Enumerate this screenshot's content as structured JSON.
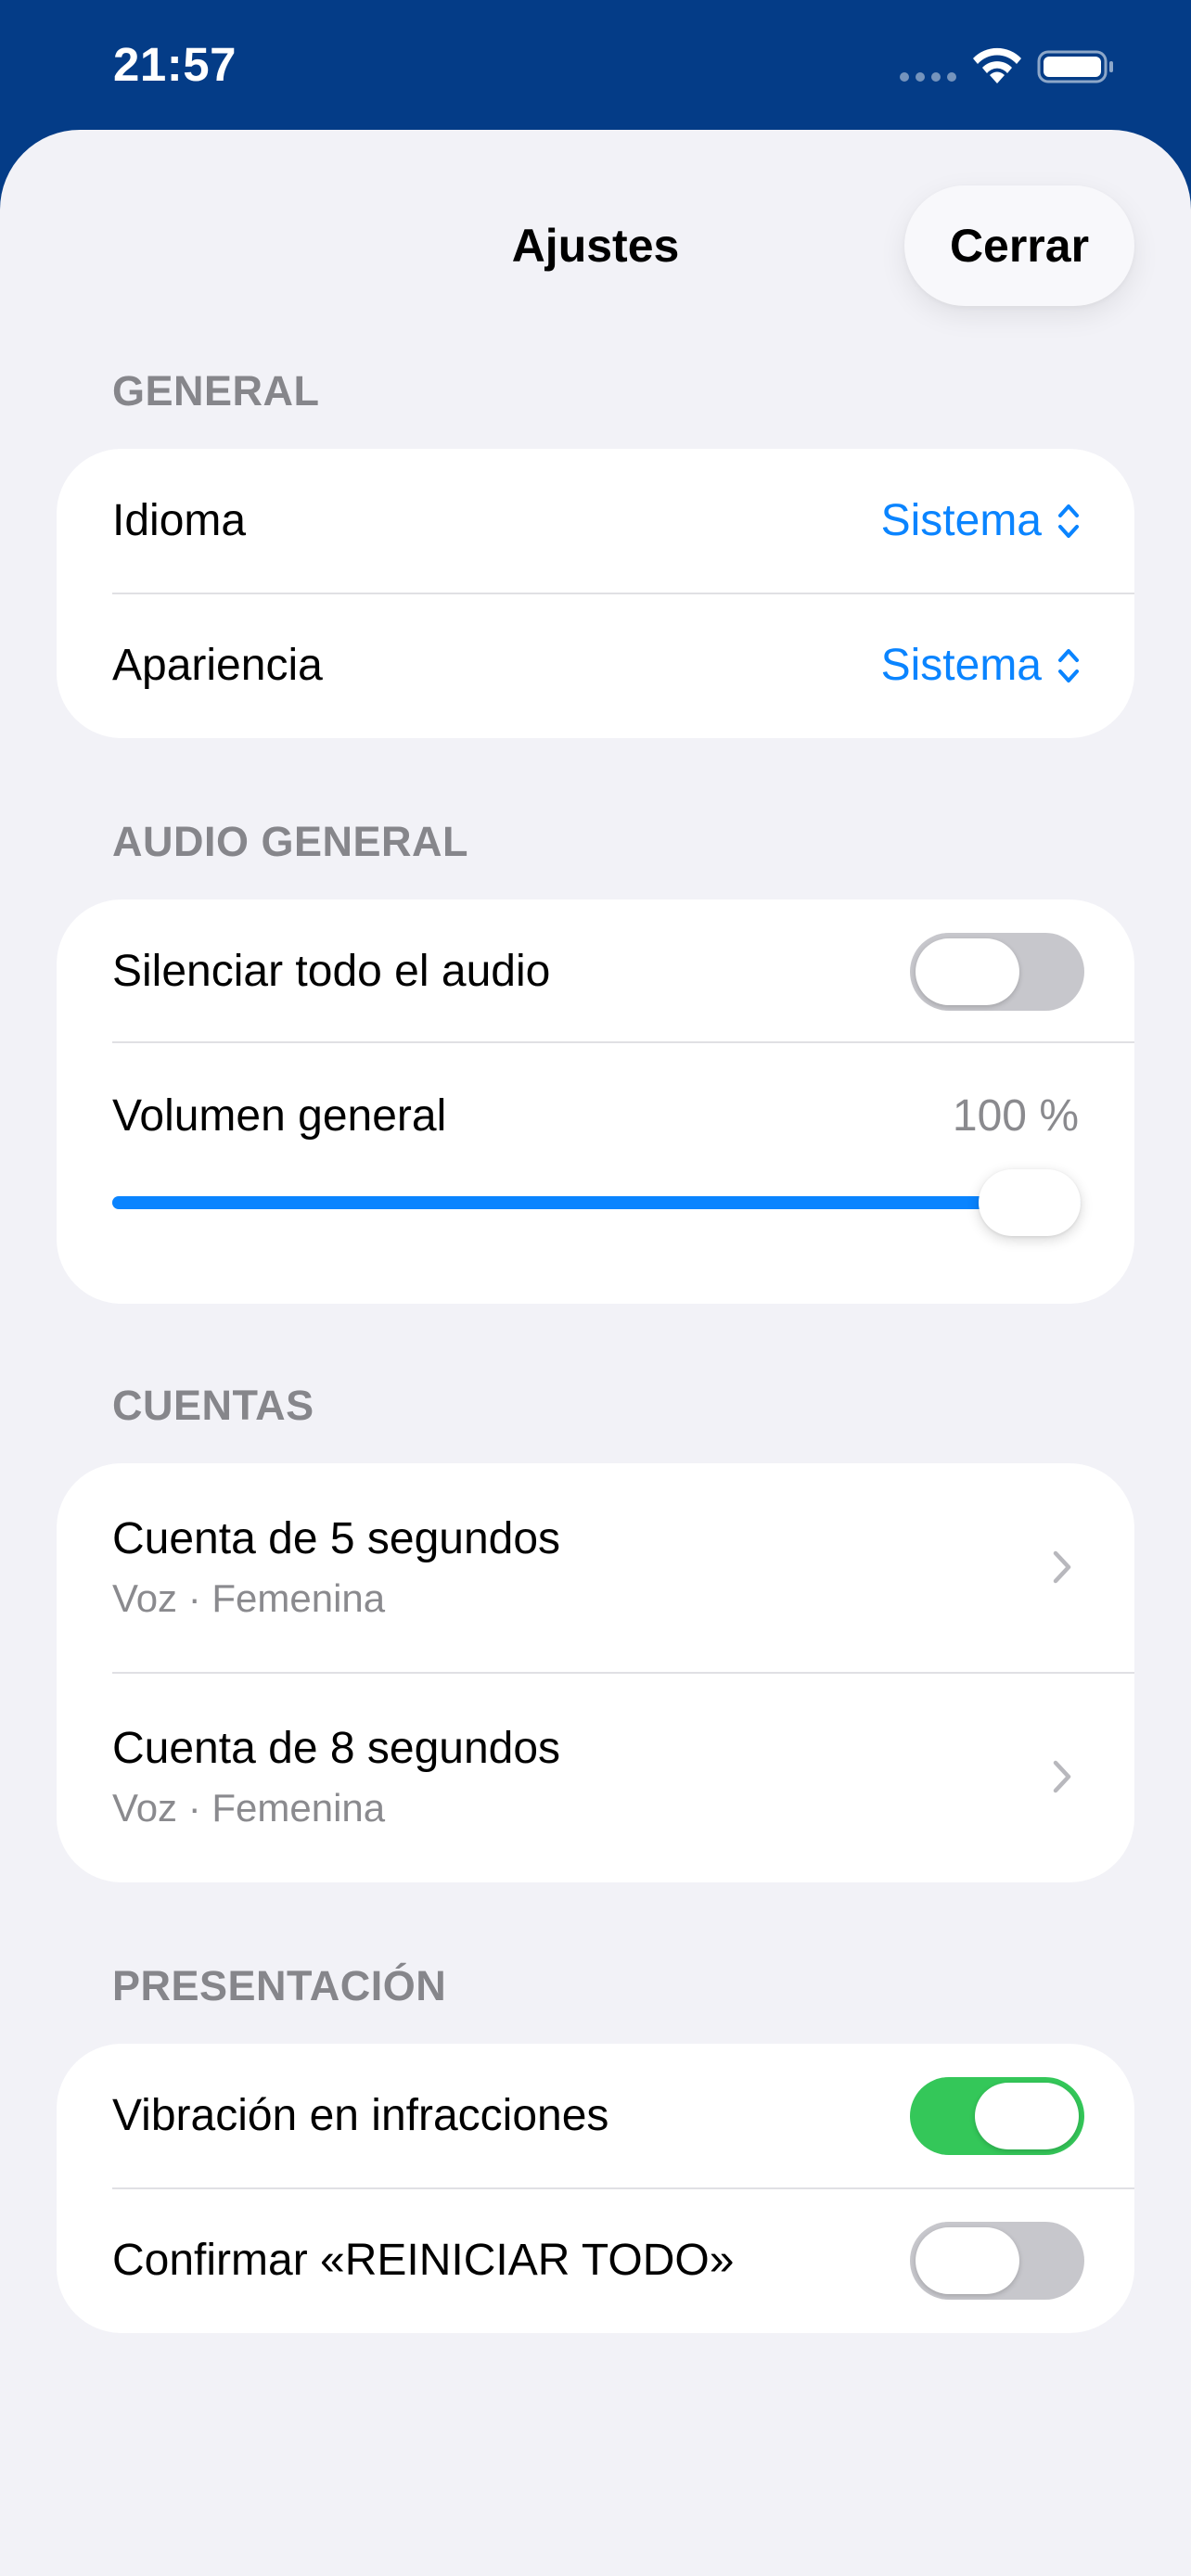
{
  "status_bar": {
    "time": "21:57",
    "signal_icon": "cellular-dots-icon",
    "wifi_icon": "wifi-icon",
    "battery_icon": "battery-icon"
  },
  "nav": {
    "title": "Ajustes",
    "close_label": "Cerrar"
  },
  "sections": {
    "general": {
      "header": "GENERAL",
      "idioma_label": "Idioma",
      "idioma_value": "Sistema",
      "apariencia_label": "Apariencia",
      "apariencia_value": "Sistema"
    },
    "audio": {
      "header": "AUDIO GENERAL",
      "mute_label": "Silenciar todo el audio",
      "mute_on": false,
      "volume_label": "Volumen general",
      "volume_text": "100 %",
      "volume_value": 1.0
    },
    "cuentas": {
      "header": "CUENTAS",
      "items": [
        {
          "title": "Cuenta de 5 segundos",
          "subtitle": "Voz · Femenina"
        },
        {
          "title": "Cuenta de 8 segundos",
          "subtitle": "Voz · Femenina"
        }
      ]
    },
    "presentacion": {
      "header": "PRESENTACIÓN",
      "vibration_label": "Vibración en infracciones",
      "vibration_on": true,
      "confirm_label": "Confirmar «REINICIAR TODO»",
      "confirm_on": false
    }
  },
  "colors": {
    "accent": "#0a84ff",
    "toggle_on": "#34c759",
    "toggle_off": "#c7c7cc",
    "header_bg": "#043c87",
    "sheet_bg": "#f2f2f7"
  }
}
